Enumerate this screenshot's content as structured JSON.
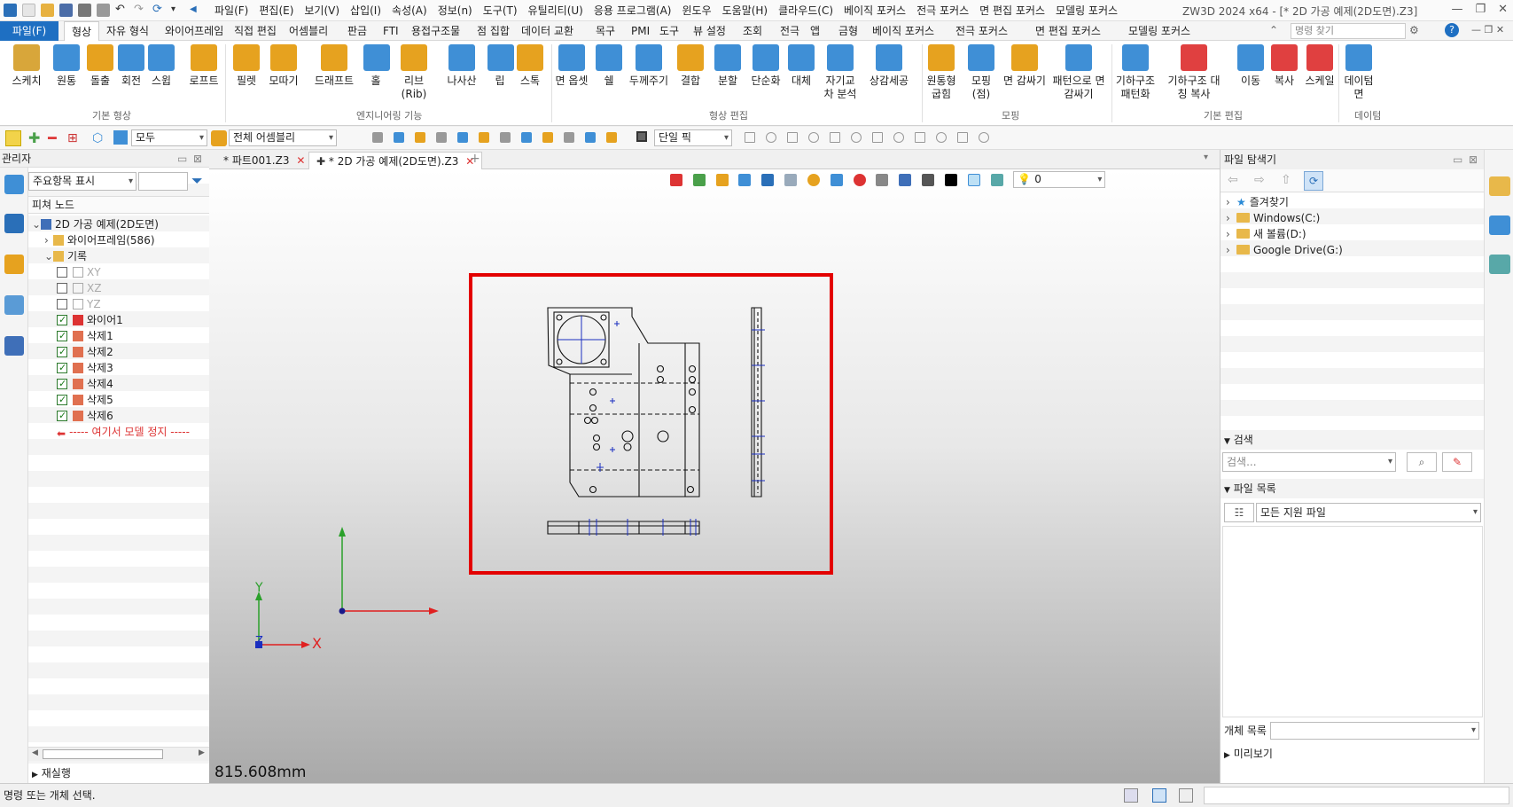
{
  "menubar": {
    "items": [
      "파일(F)",
      "편집(E)",
      "보기(V)",
      "삽입(I)",
      "속성(A)",
      "정보(n)",
      "도구(T)",
      "유틸리티(U)",
      "응용 프로그램(A)",
      "윈도우",
      "도움말(H)",
      "클라우드(C)",
      "베이직 포커스",
      "전극 포커스",
      "면 편집 포커스",
      "모델링 포커스"
    ],
    "window_title": "ZW3D 2024 x64 - [* 2D 가공 예제(2D도면).Z3]"
  },
  "ribbon_tabs": [
    "파일(F)",
    "형상",
    "자유 형식",
    "와이어프레임",
    "직접 편집",
    "어셈블리",
    "판금",
    "FTI",
    "용접구조물",
    "점 집합",
    "데이터 교환",
    "목구",
    "PMI",
    "도구",
    "뷰 설정",
    "조회",
    "전극",
    "앱",
    "금형",
    "베이직 포커스",
    "전극 포커스",
    "면 편집 포커스",
    "모델링 포커스"
  ],
  "search_placeholder": "명령 찾기",
  "ribbon": {
    "buttons": [
      {
        "label": "스케치",
        "color": "#d8a63a"
      },
      {
        "label": "원통",
        "color": "#3f8fd6"
      },
      {
        "label": "돌출",
        "color": "#e6a21f"
      },
      {
        "label": "회전",
        "color": "#3f8fd6"
      },
      {
        "label": "스윕",
        "color": "#3f8fd6"
      },
      {
        "label": "로프트",
        "color": "#e6a21f"
      },
      {
        "label": "필렛",
        "color": "#e6a21f"
      },
      {
        "label": "모따기",
        "color": "#e6a21f"
      },
      {
        "label": "드래프트",
        "color": "#e6a21f"
      },
      {
        "label": "홀",
        "color": "#3f8fd6"
      },
      {
        "label": "리브(Rib)",
        "color": "#e6a21f"
      },
      {
        "label": "나사산",
        "color": "#3f8fd6"
      },
      {
        "label": "립",
        "color": "#3f8fd6"
      },
      {
        "label": "스톡",
        "color": "#e6a21f"
      },
      {
        "label": "면 옵셋",
        "color": "#3f8fd6"
      },
      {
        "label": "쉘",
        "color": "#3f8fd6"
      },
      {
        "label": "두께주기",
        "color": "#3f8fd6"
      },
      {
        "label": "결합",
        "color": "#e6a21f"
      },
      {
        "label": "분할",
        "color": "#3f8fd6"
      },
      {
        "label": "단순화",
        "color": "#3f8fd6"
      },
      {
        "label": "대체",
        "color": "#3f8fd6"
      },
      {
        "label": "자기교차 분석",
        "color": "#3f8fd6"
      },
      {
        "label": "상감세공",
        "color": "#3f8fd6"
      },
      {
        "label": "원통형 굽힘",
        "color": "#e6a21f"
      },
      {
        "label": "모핑 (점)",
        "color": "#3f8fd6"
      },
      {
        "label": "면 감싸기",
        "color": "#e6a21f"
      },
      {
        "label": "패턴으로 면 감싸기",
        "color": "#3f8fd6"
      },
      {
        "label": "기하구조 패턴화",
        "color": "#3f8fd6"
      },
      {
        "label": "기하구조 대칭 복사",
        "color": "#e04040"
      },
      {
        "label": "이동",
        "color": "#3f8fd6"
      },
      {
        "label": "복사",
        "color": "#e04040"
      },
      {
        "label": "스케일",
        "color": "#e04040"
      },
      {
        "label": "데이텀 면",
        "color": "#3f8fd6"
      }
    ],
    "groups": [
      "기본 형상",
      "엔지니어링 기능",
      "형상 편집",
      "모핑",
      "기본 편집",
      "데이텀"
    ]
  },
  "toolbar2": {
    "filter": "모두",
    "assembly": "전체 어셈블리",
    "pick_mode": "단일 픽"
  },
  "left_panel": {
    "title": "관리자",
    "filter_combo": "주요항목 표시",
    "header": "피쳐 노드",
    "tree": [
      {
        "label": "2D 가공 예제(2D도면)",
        "indent": 0,
        "check": null,
        "expand": "-"
      },
      {
        "label": "와이어프레임(586)",
        "indent": 1,
        "check": null,
        "expand": ">"
      },
      {
        "label": "기록",
        "indent": 1,
        "check": null,
        "expand": "-"
      },
      {
        "label": "XY",
        "indent": 2,
        "check": false
      },
      {
        "label": "XZ",
        "indent": 2,
        "check": false
      },
      {
        "label": "YZ",
        "indent": 2,
        "check": false
      },
      {
        "label": "와이어1",
        "indent": 2,
        "check": true
      },
      {
        "label": "삭제1",
        "indent": 2,
        "check": true
      },
      {
        "label": "삭제2",
        "indent": 2,
        "check": true
      },
      {
        "label": "삭제3",
        "indent": 2,
        "check": true
      },
      {
        "label": "삭제4",
        "indent": 2,
        "check": true
      },
      {
        "label": "삭제5",
        "indent": 2,
        "check": true
      },
      {
        "label": "삭제6",
        "indent": 2,
        "check": true
      },
      {
        "label": "----- 여기서 모델 정지 -----",
        "indent": 2,
        "check": null,
        "stop": true
      }
    ],
    "rerun": "재실행"
  },
  "doc_tabs": [
    "* 파트001.Z3",
    "* 2D 가공 예제(2D도면).Z3"
  ],
  "viewport": {
    "layer": "0",
    "scale": "815.608mm",
    "axis_x": "X",
    "axis_y": "Y",
    "axis_z": "Z"
  },
  "right_panel": {
    "title": "파일 탐색기",
    "tree": [
      "즐겨찾기",
      "Windows(C:)",
      "새 볼륨(D:)",
      "Google Drive(G:)"
    ],
    "search_title": "검색",
    "search_placeholder": "검색...",
    "file_list_title": "파일 목록",
    "file_filter": "모든 지원 파일",
    "object_list": "개체 목록",
    "preview": "미리보기"
  },
  "status": "명령 또는 개체 선택."
}
